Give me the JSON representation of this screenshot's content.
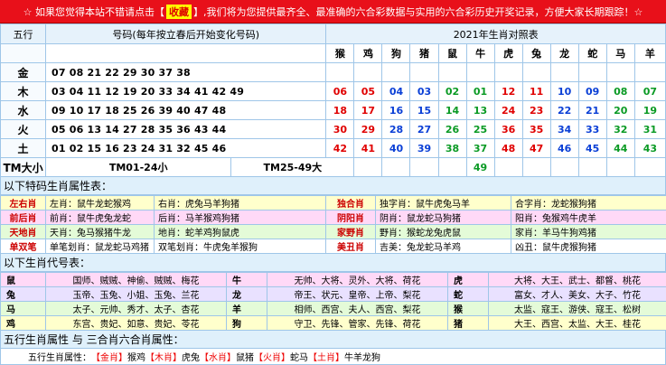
{
  "banner": {
    "pre": "☆ 如果您觉得本站不错请点击【",
    "highlight": "收藏",
    "post": "】,我们将为您提供最齐全、最准确的六合彩数据与实用的六合彩历史开奖记录，方便大家长期跟踪！☆"
  },
  "main": {
    "col_element": "五行",
    "col_numbers": "号码(每年按立春后开始变化号码)",
    "col_year": "2021年生肖对照表",
    "zodiac_header": [
      "猴",
      "鸡",
      "狗",
      "猪",
      "鼠",
      "牛",
      "虎",
      "兔",
      "龙",
      "蛇",
      "马",
      "羊"
    ],
    "rows": [
      {
        "element": "金",
        "numbers": "07 08 21 22 29 30 37 38",
        "zodiac": [
          "",
          "",
          "",
          "",
          "",
          "",
          "",
          "",
          "",
          "",
          "",
          ""
        ]
      },
      {
        "element": "木",
        "numbers": "03 04 11 12 19 20 33 34 41 42 49",
        "zodiac": [
          "06",
          "05",
          "04",
          "03",
          "02",
          "01",
          "12",
          "11",
          "10",
          "09",
          "08",
          "07"
        ]
      },
      {
        "element": "水",
        "numbers": "09 10 17 18 25 26 39 40 47 48",
        "zodiac": [
          "18",
          "17",
          "16",
          "15",
          "14",
          "13",
          "24",
          "23",
          "22",
          "21",
          "20",
          "19"
        ]
      },
      {
        "element": "火",
        "numbers": "05 06 13 14 27 28 35 36 43 44",
        "zodiac": [
          "30",
          "29",
          "28",
          "27",
          "26",
          "25",
          "36",
          "35",
          "34",
          "33",
          "32",
          "31"
        ]
      },
      {
        "element": "土",
        "numbers": "01 02 15 16 23 24 31 32 45 46",
        "zodiac": [
          "42",
          "41",
          "40",
          "39",
          "38",
          "37",
          "48",
          "47",
          "46",
          "45",
          "44",
          "43"
        ]
      }
    ],
    "size_row": {
      "label": "TM大小",
      "small": "TM01-24小",
      "big": "TM25-49大",
      "extra": "49"
    },
    "number_colors": [
      "red",
      "red",
      "blue",
      "blue",
      "green",
      "green",
      "red",
      "red",
      "blue",
      "blue",
      "green",
      "green"
    ]
  },
  "section1": {
    "title": "以下特码生肖属性表：",
    "rows": [
      {
        "c": [
          "左右肖",
          "左肖：鼠牛龙蛇猴鸡",
          "右肖：虎兔马羊狗猪",
          "独合肖",
          "独字肖：鼠牛虎兔马羊",
          "合字肖：龙蛇猴狗猪"
        ]
      },
      {
        "c": [
          "前后肖",
          "前肖：鼠牛虎兔龙蛇",
          "后肖：马羊猴鸡狗猪",
          "阴阳肖",
          "阴肖：鼠龙蛇马狗猪",
          "阳肖：兔猴鸡牛虎羊"
        ]
      },
      {
        "c": [
          "天地肖",
          "天肖：兔马猴猪牛龙",
          "地肖：蛇羊鸡狗鼠虎",
          "家野肖",
          "野肖：猴蛇龙兔虎鼠",
          "家肖：羊马牛狗鸡猪"
        ]
      },
      {
        "c": [
          "单双笔",
          "单笔划肖：鼠龙蛇马鸡猪",
          "双笔划肖：牛虎兔羊猴狗",
          "美丑肖",
          "吉美：兔龙蛇马羊鸡",
          "凶丑：鼠牛虎猴狗猪"
        ]
      }
    ]
  },
  "section2": {
    "title": "以下生肖代号表：",
    "rows": [
      {
        "c": [
          "鼠",
          "国师、贼贼、神偷、贼贼、梅花",
          "牛",
          "无帅、大将、灵外、大将、荷花",
          "虎",
          "大将、大王、武士、都督、桃花"
        ]
      },
      {
        "c": [
          "兔",
          "玉帝、玉兔、小姐、玉兔、兰花",
          "龙",
          "帝王、状元、皇帝、上帝、梨花",
          "蛇",
          "富女、才人、美女、大子、竹花"
        ]
      },
      {
        "c": [
          "马",
          "太子、元帅、秀才、太子、杏花",
          "羊",
          "相师、西宫、夫人、西宫、梨花",
          "猴",
          "太监、寇王、游侠、寇王、松树"
        ]
      },
      {
        "c": [
          "鸡",
          "东宫、贵妃、如意、贵妃、苓花",
          "狗",
          "守卫、先锋、管家、先锋、荷花",
          "猪",
          "大王、西宫、太监、大王、桂花"
        ]
      }
    ]
  },
  "section3": {
    "title": "五行生肖属性 与 三合肖六合肖属性：",
    "line_pre": "五行生肖属性：",
    "items": [
      {
        "tag": "【金肖】",
        "val": "猴鸡"
      },
      {
        "tag": "【木肖】",
        "val": "虎兔"
      },
      {
        "tag": "【水肖】",
        "val": "鼠猪"
      },
      {
        "tag": "【火肖】",
        "val": "蛇马"
      },
      {
        "tag": "【土肖】",
        "val": "牛羊龙狗"
      }
    ]
  }
}
